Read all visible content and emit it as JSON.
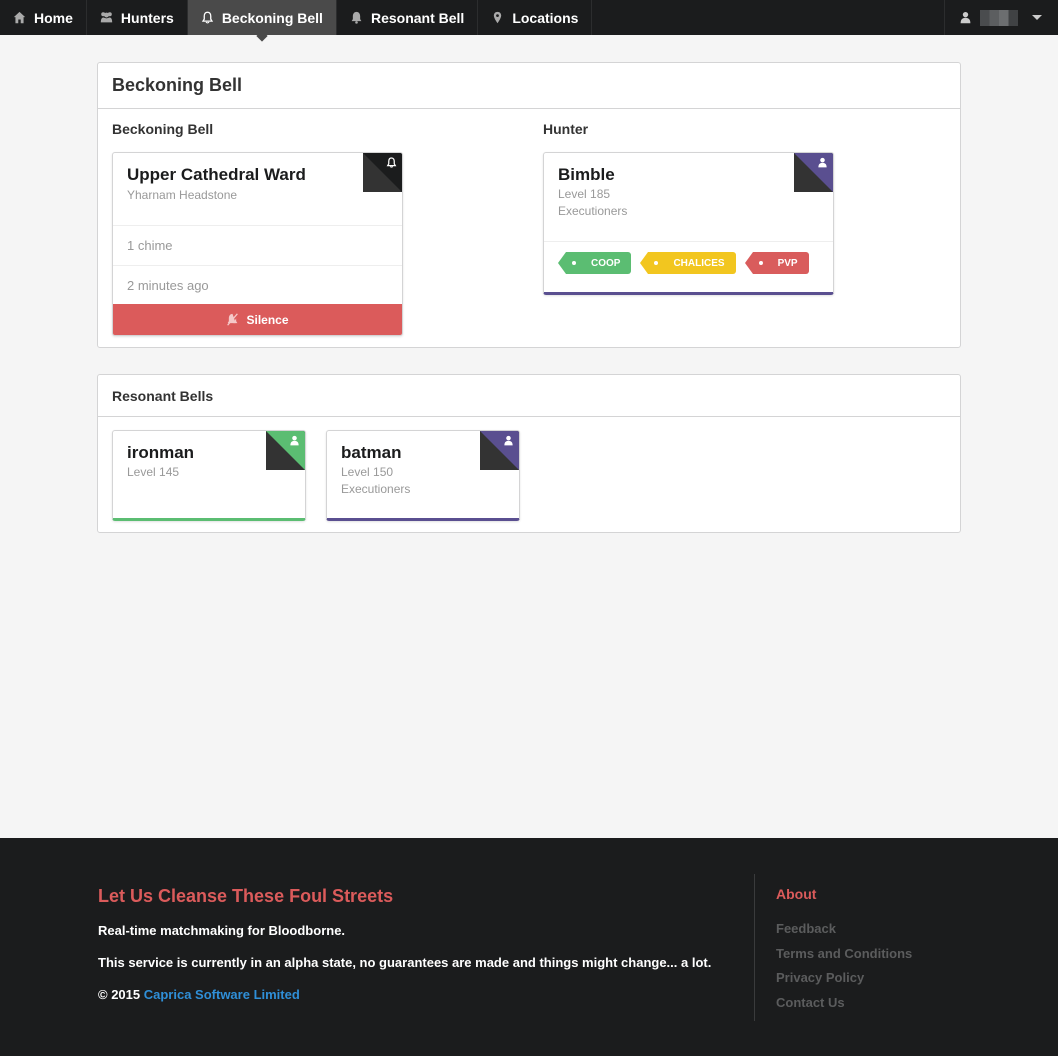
{
  "nav": {
    "items": [
      {
        "label": "Home",
        "icon": "home-icon"
      },
      {
        "label": "Hunters",
        "icon": "users-icon"
      },
      {
        "label": "Beckoning Bell",
        "icon": "bell-outline-icon",
        "active": true
      },
      {
        "label": "Resonant Bell",
        "icon": "bell-icon"
      },
      {
        "label": "Locations",
        "icon": "map-marker-icon"
      }
    ],
    "user_icon": "user-icon",
    "dropdown_icon": "caret-down-icon"
  },
  "beckoning": {
    "header": "Beckoning Bell",
    "bell_column_title": "Beckoning Bell",
    "hunter_column_title": "Hunter",
    "bell_card": {
      "title": "Upper Cathedral Ward",
      "subtitle": "Yharnam Headstone",
      "chimes": "1 chime",
      "time": "2 minutes ago",
      "silence_label": "Silence",
      "corner_color": "#1b1c1d"
    },
    "hunter_card": {
      "name": "Bimble",
      "level": "Level 185",
      "covenant": "Executioners",
      "corner_color": "#5a4f90",
      "tags": [
        {
          "label": "COOP",
          "color": "#5bbd72"
        },
        {
          "label": "CHALICES",
          "color": "#f2c61f"
        },
        {
          "label": "PVP",
          "color": "#d95c5c"
        }
      ]
    }
  },
  "resonant": {
    "header": "Resonant Bells",
    "cards": [
      {
        "name": "ironman",
        "level": "Level 145",
        "covenant": "",
        "color": "#5bbd72"
      },
      {
        "name": "batman",
        "level": "Level 150",
        "covenant": "Executioners",
        "color": "#5a4f90"
      }
    ]
  },
  "footer": {
    "title": "Let Us Cleanse These Foul Streets",
    "line1": "Real-time matchmaking for Bloodborne.",
    "line2": "This service is currently in an alpha state, no guarantees are made and things might change... a lot.",
    "copyright": "© 2015",
    "company_link": "Caprica Software Limited",
    "about_title": "About",
    "about_links": [
      "Feedback",
      "Terms and Conditions",
      "Privacy Policy",
      "Contact Us"
    ]
  }
}
